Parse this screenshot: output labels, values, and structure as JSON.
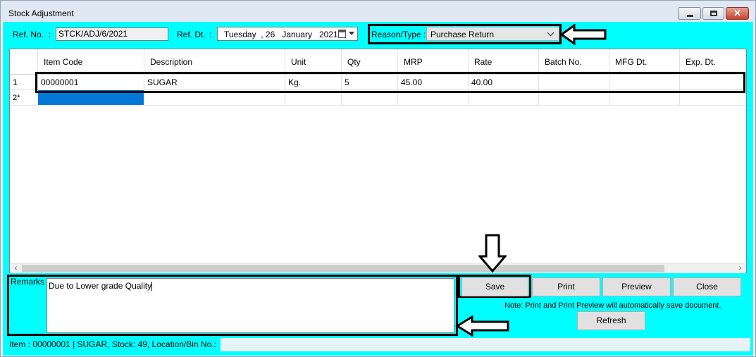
{
  "window": {
    "title": "Stock Adjustment"
  },
  "header": {
    "ref_no_label": "Ref. No.",
    "ref_no_colon": ":",
    "ref_no_value": "STCK/ADJ/6/2021",
    "ref_dt_label": "Ref. Dt.",
    "ref_dt_colon": ":",
    "ref_dt_value": "Tuesday  , 26   January   2021",
    "reason_label": "Reason/Type :",
    "reason_value": "Purchase Return"
  },
  "grid": {
    "columns": [
      "",
      "Item Code",
      "Description",
      "Unit",
      "Qty",
      "MRP",
      "Rate",
      "Batch No.",
      "MFG Dt.",
      "Exp. Dt."
    ],
    "rows": [
      {
        "index": "1",
        "item_code": "00000001",
        "description": "SUGAR",
        "unit": "Kg.",
        "qty": "5",
        "mrp": "45.00",
        "rate": "40.00",
        "batch_no": "",
        "mfg_dt": "",
        "exp_dt": ""
      }
    ],
    "new_row_marker": "2*"
  },
  "remarks": {
    "label": "Remarks :",
    "value": "Due to Lower grade Quality"
  },
  "buttons": {
    "save": "Save",
    "print": "Print",
    "preview": "Preview",
    "close": "Close",
    "refresh": "Refresh"
  },
  "note": "Note: Print and Print Preview will automatically save document.",
  "status": {
    "text": "Item : 00000001 | SUGAR, Stock: 49, Location/Bin No.:"
  },
  "icons": {
    "calendar": "calendar-icon",
    "dropdown": "chevron-down-icon",
    "scroll_left": "scroll-left-icon",
    "scroll_right": "scroll-right-icon"
  },
  "colors": {
    "client_bg": "#00ffff",
    "selection": "#0078d7"
  }
}
